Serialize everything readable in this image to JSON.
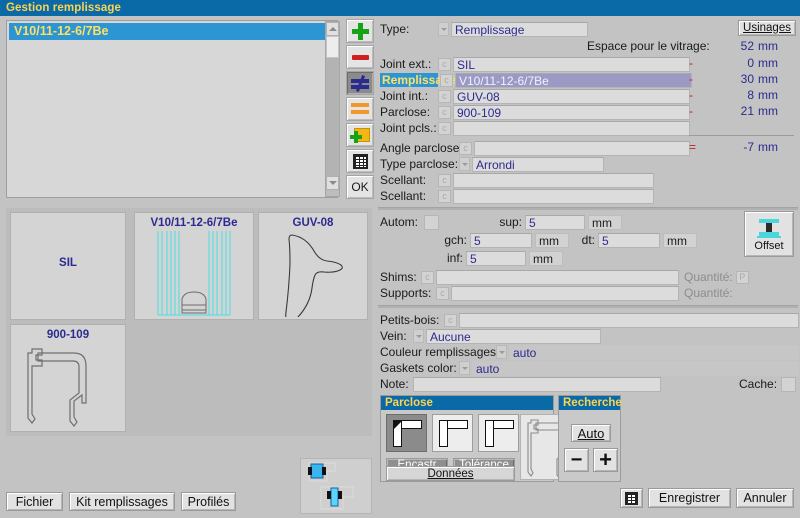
{
  "window": {
    "title": "Gestion remplissage"
  },
  "list": {
    "items": [
      {
        "label": "V10/11-12-6/7Be",
        "selected": true
      }
    ]
  },
  "toolbar": {
    "items": [
      {
        "name": "add-icon",
        "glyph": "plus-green"
      },
      {
        "name": "remove-icon",
        "glyph": "minus-red"
      },
      {
        "name": "not-equal-icon",
        "glyph": "not-equal-blue"
      },
      {
        "name": "equal-icon",
        "glyph": "equal-orange"
      },
      {
        "name": "add-folder-icon",
        "glyph": "folder-plus"
      },
      {
        "name": "grid-icon",
        "glyph": "grid"
      }
    ],
    "ok_label": "OK"
  },
  "previews": [
    {
      "title": "SIL",
      "kind": "empty"
    },
    {
      "title": "V10/11-12-6/7Be",
      "kind": "glazing"
    },
    {
      "title": "GUV-08",
      "kind": "gasket"
    },
    {
      "title": "900-109",
      "kind": "bead"
    }
  ],
  "form": {
    "usinages_label": "Usinages",
    "type_label": "Type:",
    "type_value": "Remplissage",
    "space_label": "Espace pour le vitrage:",
    "space_value": "52",
    "rows": [
      {
        "label": "Joint ext.:",
        "value": "SIL",
        "op": "-",
        "num": "0",
        "unit": "mm",
        "highlight": false,
        "selected": false
      },
      {
        "label": "Remplissage:",
        "value": "V10/11-12-6/7Be",
        "op": "-",
        "num": "30",
        "unit": "mm",
        "highlight": true,
        "selected": true
      },
      {
        "label": "Joint int.:",
        "value": "GUV-08",
        "op": "-",
        "num": "8",
        "unit": "mm",
        "highlight": false,
        "selected": false
      },
      {
        "label": "Parclose:",
        "value": "900-109",
        "op": "-",
        "num": "21",
        "unit": "mm",
        "highlight": false,
        "selected": false
      },
      {
        "label": "Joint pcls.:",
        "value": "",
        "op": "",
        "num": "",
        "unit": "",
        "highlight": false,
        "selected": false
      }
    ],
    "angle_label": "Angle parclose:",
    "angle_value": "",
    "angle_op": "=",
    "angle_num": "-7",
    "angle_unit": "mm",
    "type_parclose_label": "Type parclose:",
    "type_parclose_value": "Arrondi",
    "scellant1_label": "Scellant:",
    "scellant1_value": "",
    "scellant2_label": "Scellant:",
    "scellant2_value": "",
    "autom_label": "Autom:",
    "sup_label": "sup:",
    "sup_value": "5",
    "sup_unit": "mm",
    "gch_label": "gch:",
    "gch_value": "5",
    "gch_unit": "mm",
    "dt_label": "dt:",
    "dt_value": "5",
    "dt_unit": "mm",
    "inf_label": "inf:",
    "inf_value": "5",
    "inf_unit": "mm",
    "offset_label": "Offset",
    "shims_label": "Shims:",
    "shims_value": "",
    "shims_qty_label": "Quantité:",
    "shims_qty_value": "P",
    "supports_label": "Supports:",
    "supports_value": "",
    "supports_qty_label": "Quantité:",
    "petitsbois_label": "Petits-bois:",
    "petitsbois_value": "",
    "vein_label": "Vein:",
    "vein_value": "Aucune",
    "couleur_label": "Couleur remplissages:",
    "couleur_value": "auto",
    "gaskets_label": "Gaskets color:",
    "gaskets_value": "auto",
    "note_label": "Note:",
    "note_value": "",
    "cache_label": "Cache:"
  },
  "parclose": {
    "header": "Parclose",
    "shapes": [
      {
        "name": "corner-mitre",
        "active": true
      },
      {
        "name": "corner-butt-left",
        "active": false
      },
      {
        "name": "corner-butt-right",
        "active": false
      }
    ],
    "encastr_label": "Encastr",
    "tolerance_label": "Tolérance",
    "donnees_label": "Données"
  },
  "recherche": {
    "header": "Recherche",
    "auto_label": "Auto",
    "minus_label": "−",
    "plus_label": "+"
  },
  "footer": {
    "left_buttons": [
      "Fichier",
      "Kit remplissages",
      "Profilés"
    ],
    "grid_icon": "grid-icon",
    "save_label": "Enregistrer",
    "cancel_label": "Annuler"
  },
  "colors": {
    "title_bar": "#0a6aa8",
    "title_text": "#ffd24d",
    "selection": "#2e95d3",
    "value_text": "#2b2b8f",
    "operator_red": "#c02020",
    "glazing_cyan": "#45dfe5"
  }
}
